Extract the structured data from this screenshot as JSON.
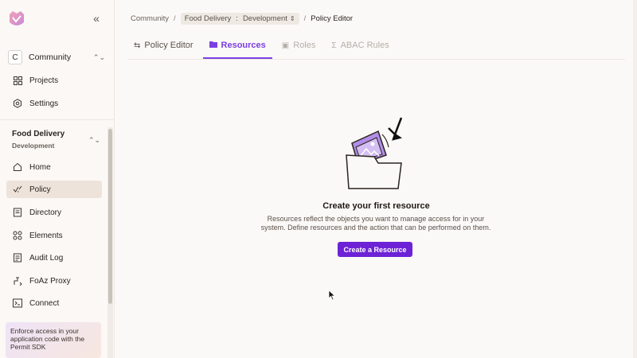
{
  "sidebar": {
    "org": {
      "avatar_letter": "C",
      "name": "Community"
    },
    "top_items": [
      {
        "label": "Projects",
        "icon": "grid-icon"
      },
      {
        "label": "Settings",
        "icon": "gear-icon"
      }
    ],
    "project": {
      "name": "Food Delivery",
      "env": "Development"
    },
    "items": [
      {
        "label": "Home",
        "icon": "home-icon"
      },
      {
        "label": "Policy",
        "icon": "policy-icon",
        "active": true
      },
      {
        "label": "Directory",
        "icon": "directory-icon"
      },
      {
        "label": "Elements",
        "icon": "elements-icon"
      },
      {
        "label": "Audit Log",
        "icon": "audit-log-icon"
      },
      {
        "label": "FoAz Proxy",
        "icon": "proxy-icon"
      },
      {
        "label": "Connect",
        "icon": "terminal-icon"
      }
    ],
    "promo": "Enforce access in your application code with the Permit SDK"
  },
  "breadcrumb": {
    "root": "Community",
    "project": "Food Delivery",
    "env": "Development",
    "current": "Policy Editor"
  },
  "tabs": [
    {
      "label": "Policy Editor",
      "icon": "sliders-icon",
      "state": "normal"
    },
    {
      "label": "Resources",
      "icon": "folder-icon",
      "state": "active"
    },
    {
      "label": "Roles",
      "icon": "roles-icon",
      "state": "disabled"
    },
    {
      "label": "ABAC Rules",
      "icon": "sigma-icon",
      "state": "disabled"
    }
  ],
  "empty_state": {
    "title": "Create your first resource",
    "description": "Resources reflect the objects you want to manage access for in your system. Define resources and the action that can be performed on them.",
    "button": "Create a Resource"
  },
  "colors": {
    "accent": "#7b3fe4",
    "button": "#6e22d6",
    "active_bg": "#ede3db"
  }
}
